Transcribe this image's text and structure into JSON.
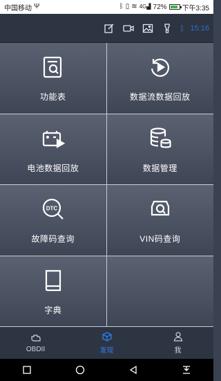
{
  "status_bar": {
    "carrier": "中国移动",
    "usb_icon": "usb-icon",
    "battery_percent": "72%",
    "time": "下午3:35",
    "battery_level": 0.72,
    "signal": "4G"
  },
  "toolbar": {
    "icons": [
      "edit-icon",
      "video-camera-icon",
      "image-icon",
      "flashlight-icon",
      "bluetooth-icon"
    ],
    "time_text": "15:16"
  },
  "grid": {
    "cells": [
      {
        "label": "功能表",
        "icon": "function-list-icon"
      },
      {
        "label": "数据流数据回放",
        "icon": "replay-icon"
      },
      {
        "label": "电池数据回放",
        "icon": "battery-replay-icon"
      },
      {
        "label": "数据管理",
        "icon": "database-icon"
      },
      {
        "label": "故障码查询",
        "icon": "dtc-search-icon"
      },
      {
        "label": "VIN码查询",
        "icon": "vin-search-icon"
      },
      {
        "label": "字典",
        "icon": "dictionary-icon"
      }
    ]
  },
  "bottom_nav": {
    "items": [
      {
        "label": "OBDII",
        "icon": "engine-icon",
        "active": false
      },
      {
        "label": "发现",
        "icon": "cube-icon",
        "active": true
      },
      {
        "label": "我",
        "icon": "user-icon",
        "active": false
      }
    ],
    "active_color": "#2f7ff0"
  },
  "system_nav": {
    "icons": [
      "recent-apps-icon",
      "home-icon",
      "back-icon",
      "notification-pull-icon"
    ]
  }
}
